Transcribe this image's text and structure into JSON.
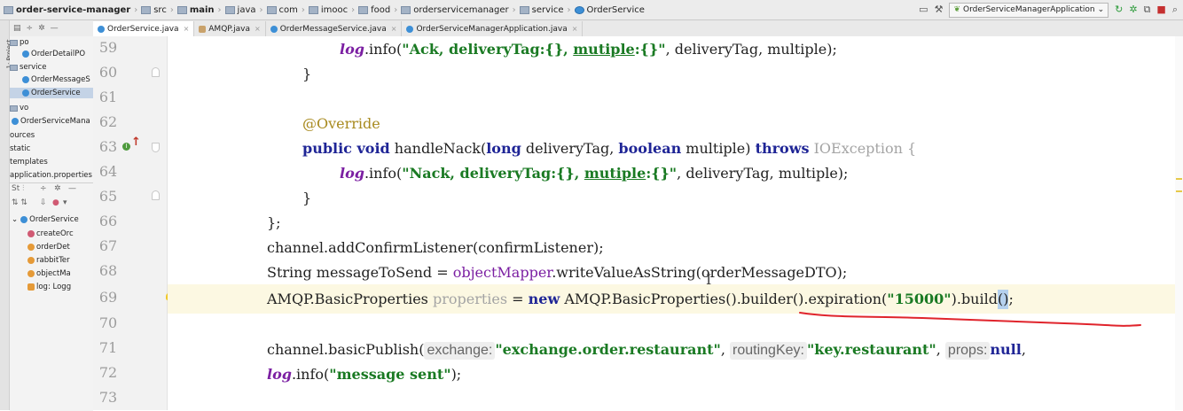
{
  "breadcrumbs": [
    "order-service-manager",
    "src",
    "main",
    "java",
    "com",
    "imooc",
    "food",
    "orderservicemanager",
    "service",
    "OrderService"
  ],
  "toolbar": {
    "run_config": "OrderServiceManagerApplication"
  },
  "tabs": [
    {
      "label": "OrderService.java",
      "active": true
    },
    {
      "label": "AMQP.java",
      "active": false
    },
    {
      "label": "OrderMessageService.java",
      "active": false
    },
    {
      "label": "OrderServiceManagerApplication.java",
      "active": false
    }
  ],
  "left_stripe": {
    "label": "1: Project"
  },
  "project_tree": [
    {
      "label": "po",
      "kind": "folder"
    },
    {
      "label": "OrderDetailPO",
      "kind": "class"
    },
    {
      "label": "service",
      "kind": "folder"
    },
    {
      "label": "OrderMessageS",
      "kind": "class"
    },
    {
      "label": "OrderService",
      "kind": "class",
      "selected": true
    },
    {
      "label": "vo",
      "kind": "folder"
    },
    {
      "label": "OrderServiceMana",
      "kind": "class"
    },
    {
      "label": "ources",
      "kind": "text"
    },
    {
      "label": "static",
      "kind": "text"
    },
    {
      "label": "templates",
      "kind": "text"
    },
    {
      "label": "application.properties",
      "kind": "text"
    }
  ],
  "structure": {
    "root": "OrderService",
    "members": [
      {
        "label": "createOrc",
        "kind": "method"
      },
      {
        "label": "orderDet",
        "kind": "field"
      },
      {
        "label": "rabbitTer",
        "kind": "field"
      },
      {
        "label": "objectMa",
        "kind": "field"
      },
      {
        "label": "log: Logg",
        "kind": "static-field"
      }
    ]
  },
  "line_numbers": [
    "59",
    "60",
    "61",
    "62",
    "63",
    "64",
    "65",
    "66",
    "67",
    "68",
    "69",
    "70",
    "71",
    "72",
    "73"
  ],
  "code": {
    "l59": {
      "method": "info(",
      "str": "\"Ack, deliveryTag:{}, ",
      "ul": "mutiple",
      "str2": ":{}\"",
      "rest": ", deliveryTag, multiple);"
    },
    "l60": "}",
    "l62": "@Override",
    "l63": {
      "kw1": "public void",
      "name": " handleNack(",
      "kw2": "long",
      "p1": " deliveryTag, ",
      "kw3": "boolean",
      "p2": " multiple) ",
      "kw4": "throws",
      "exc": " IOException {"
    },
    "l64": {
      "method": "info(",
      "str": "\"Nack, deliveryTag:{}, ",
      "ul": "mutiple",
      "str2": ":{}\"",
      "rest": ", deliveryTag, multiple);"
    },
    "l65": "}",
    "l66": "};",
    "l67": "channel.addConfirmListener(confirmListener);",
    "l68": {
      "a": "String messageToSend = ",
      "field": "objectMapper",
      "b": ".writeValueAsString(orderMessageDTO);"
    },
    "l69": {
      "a": "AMQP.BasicProperties ",
      "unused": "properties",
      "b": " = ",
      "kw": "new",
      "c": " AMQP.BasicProperties().builder().expiration(",
      "str": "\"15000\"",
      "d": ").build",
      "sel": "()",
      "e": ";"
    },
    "l71": {
      "a": "channel.basicPublish(",
      "h1": "exchange:",
      "s1": "\"exchange.order.restaurant\"",
      "h2": "routingKey:",
      "s2": "\"key.restaurant\"",
      "h3": "props:",
      "kw": "null",
      "tail": ","
    },
    "l72": {
      "method": "info(",
      "str": "\"message sent\"",
      "rest": ");"
    },
    "log": "log",
    "dot": "."
  }
}
